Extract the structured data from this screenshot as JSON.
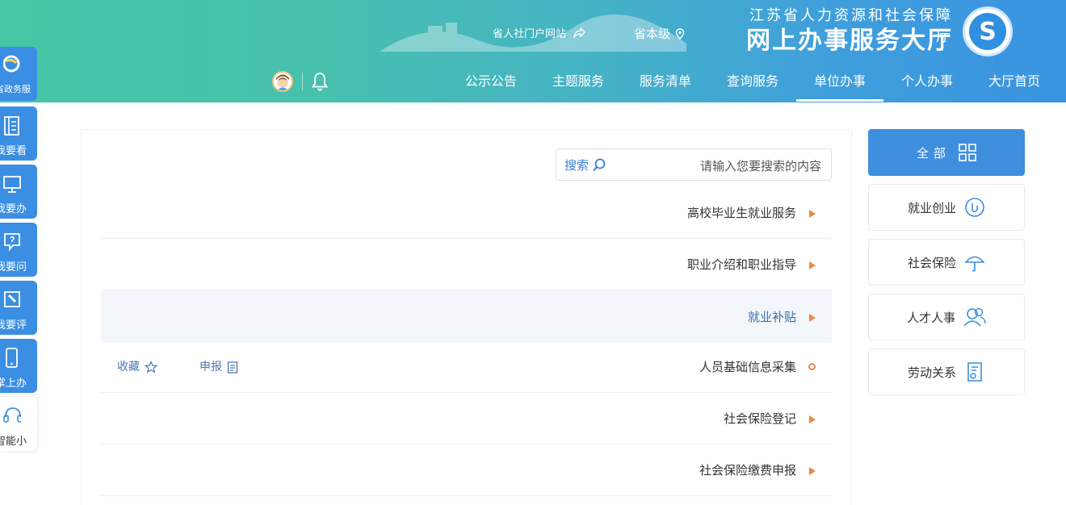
{
  "header": {
    "site_subtitle": "江苏省人力资源和社会保障厅",
    "site_title": "网上办事服务大厅",
    "region": "省本级",
    "portal_link": "省人社门户网站"
  },
  "nav": {
    "items": [
      {
        "label": "大厅首页",
        "active": false
      },
      {
        "label": "个人办事",
        "active": false
      },
      {
        "label": "单位办事",
        "active": true
      },
      {
        "label": "查询服务",
        "active": false
      },
      {
        "label": "服务清单",
        "active": false
      },
      {
        "label": "主题服务",
        "active": false
      },
      {
        "label": "公示公告",
        "active": false
      }
    ]
  },
  "float_bar": {
    "items": [
      {
        "label": "省政务服",
        "icon": "government-service-icon"
      },
      {
        "label": "我要看",
        "icon": "book-icon"
      },
      {
        "label": "我要办",
        "icon": "monitor-icon"
      },
      {
        "label": "我要问",
        "icon": "chat-question-icon"
      },
      {
        "label": "我要评",
        "icon": "edit-icon"
      },
      {
        "label": "掌上办",
        "icon": "mobile-icon"
      },
      {
        "label": "智能小",
        "icon": "headset-icon"
      }
    ]
  },
  "categories": {
    "items": [
      {
        "label": "全部",
        "icon": "grid-icon",
        "active": true
      },
      {
        "label": "就业创业",
        "icon": "employment-icon",
        "active": false
      },
      {
        "label": "社会保险",
        "icon": "umbrella-icon",
        "active": false
      },
      {
        "label": "人才人事",
        "icon": "people-icon",
        "active": false
      },
      {
        "label": "劳动关系",
        "icon": "contract-icon",
        "active": false
      }
    ]
  },
  "search": {
    "placeholder": "请输入您要搜索的内容",
    "button": "搜索"
  },
  "list": {
    "rows": [
      {
        "name": "高校毕业生就业服务",
        "marker": "arrow"
      },
      {
        "name": "职业介绍和职业指导",
        "marker": "arrow"
      },
      {
        "name": "就业补贴",
        "marker": "arrow",
        "highlighted": true
      },
      {
        "name": "人员基础信息采集",
        "marker": "circle",
        "actions": [
          "申报",
          "收藏"
        ]
      },
      {
        "name": "社会保险登记",
        "marker": "arrow"
      },
      {
        "name": "社会保险缴费申报",
        "marker": "arrow"
      }
    ]
  },
  "colors": {
    "primary": "#3a8ee3",
    "accent_orange": "#e88a4a",
    "link": "#4a78b5"
  }
}
